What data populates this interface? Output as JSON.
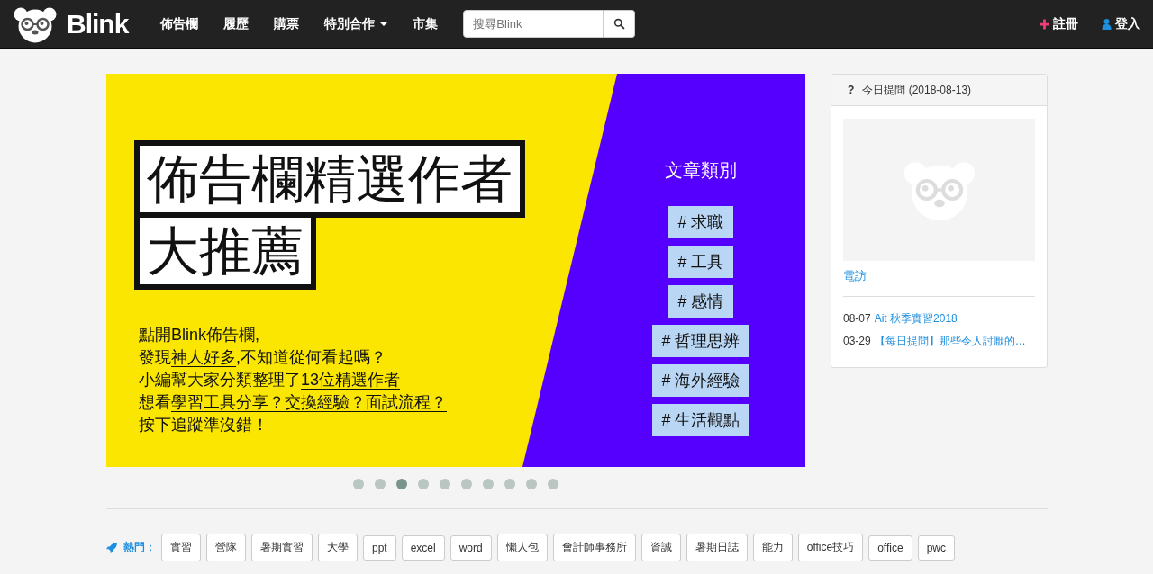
{
  "navbar": {
    "brand": "Blink",
    "items": [
      {
        "label": "佈告欄",
        "dropdown": false
      },
      {
        "label": "履歷",
        "dropdown": false
      },
      {
        "label": "購票",
        "dropdown": false
      },
      {
        "label": "特別合作",
        "dropdown": true
      },
      {
        "label": "市集",
        "dropdown": false
      }
    ],
    "search": {
      "placeholder": "搜尋Blink"
    },
    "actions": [
      {
        "kind": "register",
        "label": "註冊"
      },
      {
        "kind": "login",
        "label": "登入"
      }
    ]
  },
  "banner": {
    "title_lines": [
      "佈告欄精選作者",
      "大推薦"
    ],
    "body_lines": [
      [
        {
          "text": "點開Blink佈告欄,",
          "underline": false
        }
      ],
      [
        {
          "text": "發現",
          "underline": false
        },
        {
          "text": "神人好多",
          "underline": true
        },
        {
          "text": ",不知道從何看起嗎？",
          "underline": false
        }
      ],
      [
        {
          "text": "小編幫大家分類整理了",
          "underline": false
        },
        {
          "text": "13位精選作者",
          "underline": true
        }
      ],
      [
        {
          "text": "想看",
          "underline": false
        },
        {
          "text": "學習工具分享？交換經驗？面試流程？",
          "underline": true
        }
      ],
      [
        {
          "text": "按下追蹤準沒錯！",
          "underline": false
        }
      ]
    ],
    "category_heading": "文章類別",
    "categories": [
      "# 求職",
      "# 工具",
      "# 感情",
      "# 哲理思辨",
      "# 海外經驗",
      "# 生活觀點"
    ]
  },
  "carousel_dots": [
    {
      "selected": false
    },
    {
      "selected": false
    },
    {
      "selected": true
    },
    {
      "selected": false
    },
    {
      "selected": false
    },
    {
      "selected": false
    },
    {
      "selected": false
    },
    {
      "selected": false
    },
    {
      "selected": false
    },
    {
      "selected": false
    }
  ],
  "daily_question": {
    "icon": "?",
    "title": "今日提問 (2018-08-13)",
    "topic": "電訪",
    "items": [
      {
        "date": "08-07",
        "title": "Ait 秋季實習2018"
      },
      {
        "date": "03-29",
        "title": "【每日提問】那些令人討厭的…"
      }
    ]
  },
  "hot_tags": {
    "label": "熱門：",
    "tags": [
      "實習",
      "營隊",
      "暑期實習",
      "大學",
      "ppt",
      "excel",
      "word",
      "懶人包",
      "會計師事務所",
      "資誠",
      "暑期日誌",
      "能力",
      "office技巧",
      "office",
      "pwc"
    ]
  }
}
